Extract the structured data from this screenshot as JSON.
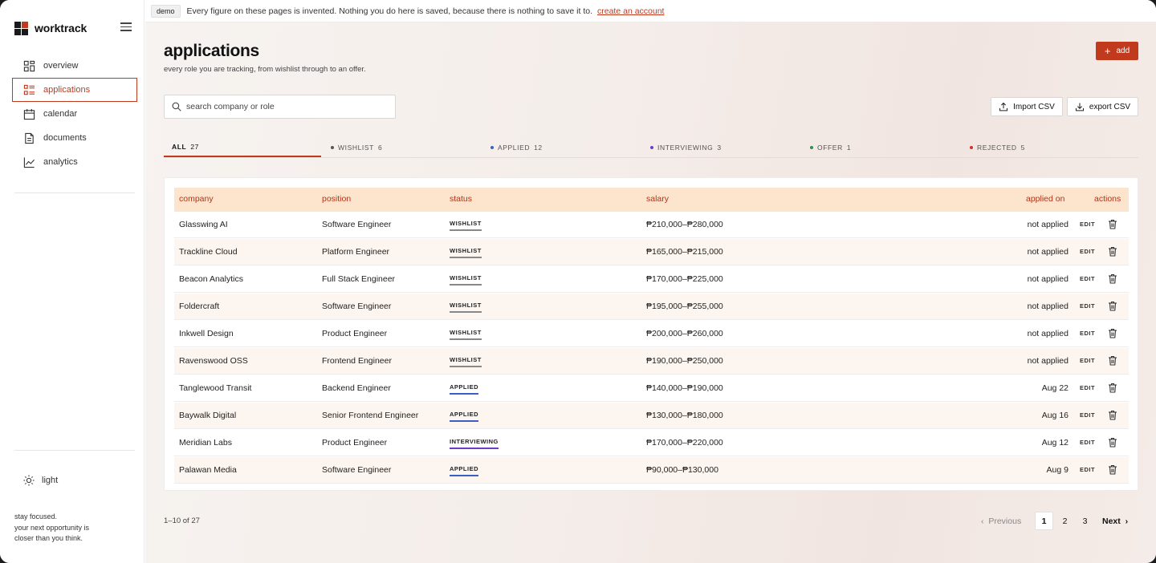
{
  "brand": {
    "name": "worktrack"
  },
  "sidebar": {
    "items": [
      {
        "label": "overview",
        "icon": "grid-icon"
      },
      {
        "label": "applications",
        "icon": "list-icon",
        "active": true
      },
      {
        "label": "calendar",
        "icon": "calendar-icon"
      },
      {
        "label": "documents",
        "icon": "document-icon"
      },
      {
        "label": "analytics",
        "icon": "chart-icon"
      }
    ],
    "theme_label": "light",
    "tagline_lines": [
      "stay focused.",
      "your next opportunity is",
      "closer than you think."
    ]
  },
  "banner": {
    "badge": "demo",
    "message": "Every figure on these pages is invented. Nothing you do here is saved, because there is nothing to save it to.",
    "link": "create an account"
  },
  "header": {
    "title": "applications",
    "subtitle": "every role you are tracking, from wishlist through to an offer.",
    "add_label": "add"
  },
  "search": {
    "placeholder": "search company or role"
  },
  "toolbar": {
    "import_label": "Import CSV",
    "export_label": "export CSV"
  },
  "tabs": [
    {
      "label": "ALL",
      "count": "27",
      "dot": ""
    },
    {
      "label": "WISHLIST",
      "count": "6",
      "dot": "#555555"
    },
    {
      "label": "APPLIED",
      "count": "12",
      "dot": "#3b5fc4"
    },
    {
      "label": "INTERVIEWING",
      "count": "3",
      "dot": "#6a3fc4"
    },
    {
      "label": "OFFER",
      "count": "1",
      "dot": "#2e8b57"
    },
    {
      "label": "REJECTED",
      "count": "5",
      "dot": "#d0312d"
    }
  ],
  "table": {
    "columns": {
      "company": "company",
      "position": "position",
      "status": "status",
      "salary": "salary",
      "applied_on": "applied on",
      "actions": "actions"
    },
    "edit_label": "EDIT",
    "rows": [
      {
        "company": "Glasswing AI",
        "position": "Software Engineer",
        "status": "WISHLIST",
        "salary": "₱210,000–₱280,000",
        "applied_on": "not applied"
      },
      {
        "company": "Trackline Cloud",
        "position": "Platform Engineer",
        "status": "WISHLIST",
        "salary": "₱165,000–₱215,000",
        "applied_on": "not applied"
      },
      {
        "company": "Beacon Analytics",
        "position": "Full Stack Engineer",
        "status": "WISHLIST",
        "salary": "₱170,000–₱225,000",
        "applied_on": "not applied"
      },
      {
        "company": "Foldercraft",
        "position": "Software Engineer",
        "status": "WISHLIST",
        "salary": "₱195,000–₱255,000",
        "applied_on": "not applied"
      },
      {
        "company": "Inkwell Design",
        "position": "Product Engineer",
        "status": "WISHLIST",
        "salary": "₱200,000–₱260,000",
        "applied_on": "not applied"
      },
      {
        "company": "Ravenswood OSS",
        "position": "Frontend Engineer",
        "status": "WISHLIST",
        "salary": "₱190,000–₱250,000",
        "applied_on": "not applied"
      },
      {
        "company": "Tanglewood Transit",
        "position": "Backend Engineer",
        "status": "APPLIED",
        "salary": "₱140,000–₱190,000",
        "applied_on": "Aug 22"
      },
      {
        "company": "Baywalk Digital",
        "position": "Senior Frontend Engineer",
        "status": "APPLIED",
        "salary": "₱130,000–₱180,000",
        "applied_on": "Aug 16"
      },
      {
        "company": "Meridian Labs",
        "position": "Product Engineer",
        "status": "INTERVIEWING",
        "salary": "₱170,000–₱220,000",
        "applied_on": "Aug 12"
      },
      {
        "company": "Palawan Media",
        "position": "Software Engineer",
        "status": "APPLIED",
        "salary": "₱90,000–₱130,000",
        "applied_on": "Aug 9"
      }
    ]
  },
  "pagination": {
    "info": "1–10 of 27",
    "previous": "Previous",
    "next": "Next",
    "pages": [
      "1",
      "2",
      "3"
    ],
    "current": "1"
  },
  "colors": {
    "accent": "#c23a1e",
    "header_bg": "#fde4cc"
  }
}
